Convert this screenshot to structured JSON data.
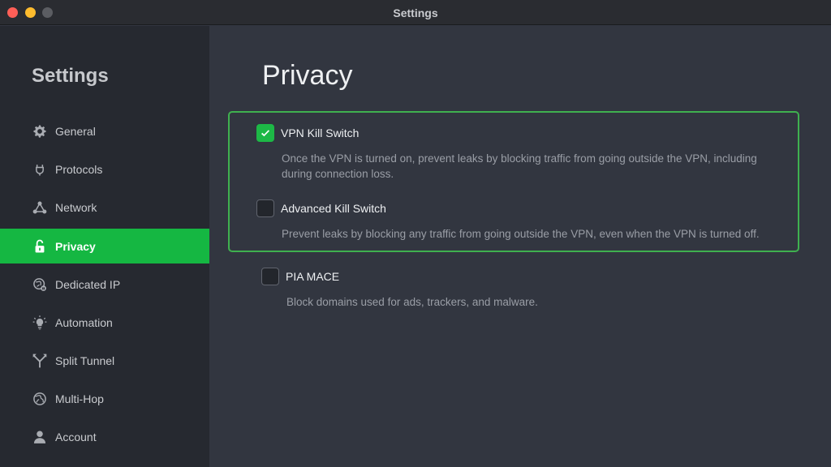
{
  "window": {
    "title": "Settings"
  },
  "sidebar": {
    "title": "Settings",
    "items": [
      {
        "label": "General",
        "icon": "gear-icon",
        "active": false
      },
      {
        "label": "Protocols",
        "icon": "protocols-icon",
        "active": false
      },
      {
        "label": "Network",
        "icon": "network-icon",
        "active": false
      },
      {
        "label": "Privacy",
        "icon": "lock-icon",
        "active": true
      },
      {
        "label": "Dedicated IP",
        "icon": "dedicated-ip-icon",
        "active": false
      },
      {
        "label": "Automation",
        "icon": "lightbulb-icon",
        "active": false
      },
      {
        "label": "Split Tunnel",
        "icon": "split-tunnel-icon",
        "active": false
      },
      {
        "label": "Multi-Hop",
        "icon": "globe-icon",
        "active": false
      },
      {
        "label": "Account",
        "icon": "user-icon",
        "active": false
      }
    ]
  },
  "main": {
    "title": "Privacy",
    "options": [
      {
        "label": "VPN Kill Switch",
        "checked": true,
        "description_line1": "Once the VPN is turned on, prevent leaks by blocking traffic from going outside the VPN, including",
        "description_line2": "during connection loss."
      },
      {
        "label": "Advanced Kill Switch",
        "checked": false,
        "description": "Prevent leaks by blocking any traffic from going outside the VPN, even when the VPN is turned off."
      },
      {
        "label": "PIA MACE",
        "checked": false,
        "description": "Block domains used for ads, trackers, and malware."
      }
    ]
  },
  "colors": {
    "accent": "#15b742",
    "group_border": "#3fb14f",
    "sidebar_bg": "#262930",
    "content_bg": "#323640"
  }
}
